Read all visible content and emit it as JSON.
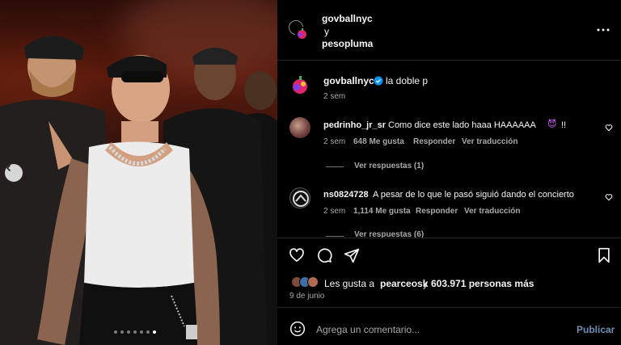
{
  "header": {
    "account": "govballnyc",
    "conjunction": "y",
    "collaborator": "pesopluma",
    "more_icon": "more-horizontal-icon"
  },
  "caption": {
    "username": "govballnyc",
    "verified": true,
    "text": "la doble p",
    "time": "2 sem"
  },
  "comments": [
    {
      "username": "pedrinho_jr_sr",
      "text": "Como dice este lado haaa HAAAAAA",
      "emoji": "😈",
      "suffix": "!!",
      "time": "2 sem",
      "likes": "648 Me gusta",
      "reply_label": "Responder",
      "translate_label": "Ver traducción",
      "view_replies": "Ver respuestas (1)"
    },
    {
      "username": "ns0824728",
      "text": "A pesar de lo que le pasó siguió dando el concierto",
      "time": "2 sem",
      "likes": "1,114 Me gusta",
      "reply_label": "Responder",
      "translate_label": "Ver traducción",
      "view_replies": "Ver respuestas (6)"
    }
  ],
  "actions": {
    "like_icon": "heart-icon",
    "comment_icon": "comment-icon",
    "share_icon": "share-icon",
    "save_icon": "bookmark-icon"
  },
  "likes": {
    "prefix": "Les gusta a",
    "user": "pearceosk",
    "connector": "y",
    "count": "603.971 personas más"
  },
  "date": "9 de junio",
  "comment_box": {
    "placeholder": "Agrega un comentario...",
    "publish_label": "Publicar",
    "emoji_icon": "smiley-icon"
  },
  "carousel": {
    "total": 7,
    "active_index": 6
  },
  "colors": {
    "background": "#000000",
    "text": "#f5f5f5",
    "secondary": "#a8a8a8",
    "verified": "#0095f6",
    "publish": "#6f8fb3"
  }
}
